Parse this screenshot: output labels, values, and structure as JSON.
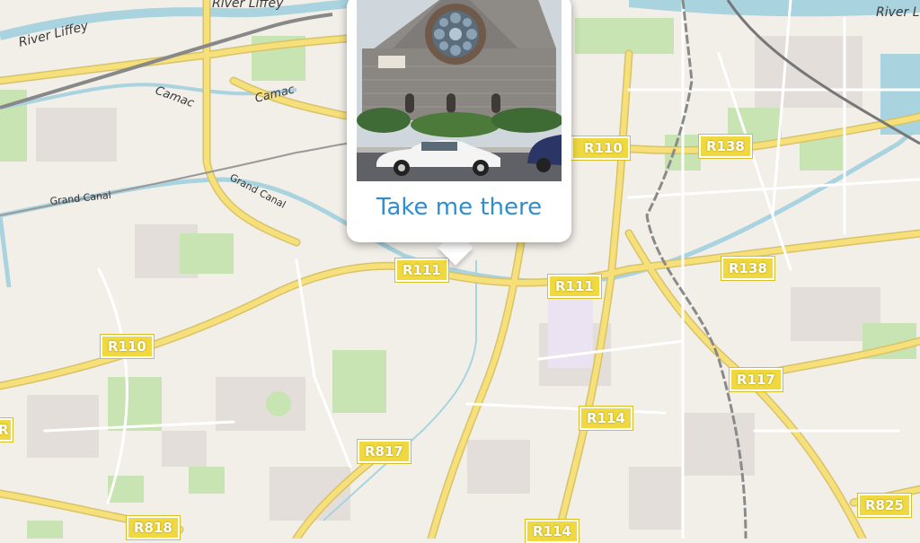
{
  "map": {
    "water_color": "#a9d3de",
    "road_color": "#f7e07a",
    "park_color": "#c8e4b2",
    "labels": {
      "river_liffey_1": "River Liffey",
      "river_liffey_2": "River Liffey",
      "river_liffey_3": "River Liffe",
      "camac_1": "Camac",
      "camac_2": "Camac",
      "grand_canal_1": "Grand Canal",
      "grand_canal_2": "Grand Canal"
    },
    "shields": {
      "r111_a": "R111",
      "r111_b": "R111",
      "r110_left": "R110",
      "r110_top": "R110",
      "r138_a": "R138",
      "r138_b": "R138",
      "r117": "R117",
      "r114_a": "R114",
      "r114_b": "R114",
      "r817": "R817",
      "r818": "R818",
      "r825": "R825",
      "edge": "R"
    }
  },
  "popup": {
    "link_label": "Take me there",
    "photo_icon": "church-photo"
  }
}
